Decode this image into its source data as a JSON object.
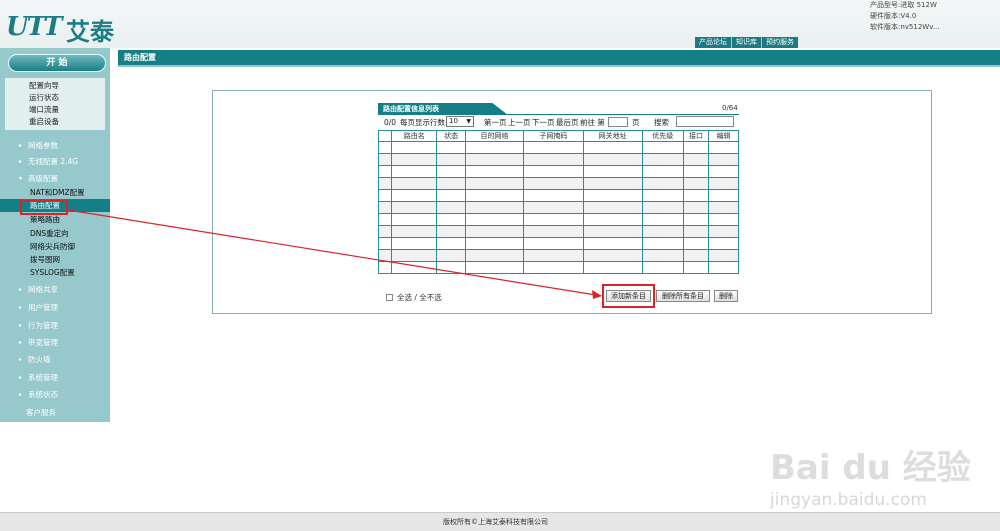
{
  "header": {
    "logo_mark": "UTT",
    "logo_text": "艾泰",
    "info_lines": [
      "产品型号:进取 512W",
      "硬件版本:V4.0",
      "软件版本:nv512Wv..."
    ],
    "nav": [
      "产品论坛",
      "知识库",
      "预约服务"
    ]
  },
  "page_title": "路由配置",
  "sidebar": {
    "start_label": "开 始",
    "quick_links": [
      "配置向导",
      "运行状态",
      "端口流量",
      "重启设备"
    ],
    "menu_top": [
      {
        "label": "网络参数",
        "arrow": "▸"
      },
      {
        "label": "无线配置 2.4G",
        "arrow": "▸"
      },
      {
        "label": "高级配置",
        "arrow": "▾"
      }
    ],
    "sub_items": [
      "NAT和DMZ配置",
      "路由配置",
      "策略路由",
      "DNS重定向",
      "网络尖兵防御",
      "拨号图网",
      "SYSLOG配置"
    ],
    "menu_bottom": [
      {
        "label": "网络共享",
        "arrow": "▸"
      },
      {
        "label": "用户管理",
        "arrow": "▸"
      },
      {
        "label": "行为管理",
        "arrow": "▸"
      },
      {
        "label": "带宽管理",
        "arrow": "▸"
      },
      {
        "label": "防火墙",
        "arrow": "▸"
      },
      {
        "label": "系统管理",
        "arrow": "▸"
      },
      {
        "label": "系统状态",
        "arrow": "▸"
      }
    ],
    "customer_service": "客户服务"
  },
  "list": {
    "tab_title": "路由配置信息列表",
    "count": "0/64",
    "pager": {
      "position": "0/0",
      "per_page_label": "每页显示行数",
      "per_page_value": "10",
      "first": "第一页",
      "prev": "上一页",
      "next": "下一页",
      "last": "最后页",
      "goto": "前往 第",
      "page_unit": "页",
      "search_label": "搜索"
    },
    "columns": [
      "",
      "路由名",
      "状态",
      "目的网络",
      "子网掩码",
      "网关地址",
      "优先级",
      "接口",
      "编辑"
    ],
    "row_count": 11
  },
  "actions": {
    "select_all": "全选 / 全不选",
    "add": "添加新条目",
    "delete_all": "删除所有条目",
    "delete": "删除"
  },
  "footer": "版权所有©上海艾泰科技有限公司",
  "watermark": {
    "brand": "Bai du 经验",
    "url": "jingyan.baidu.com"
  },
  "colors": {
    "accent": "#147f87",
    "sidebar": "#96c8cc",
    "highlight": "#d8252b"
  }
}
